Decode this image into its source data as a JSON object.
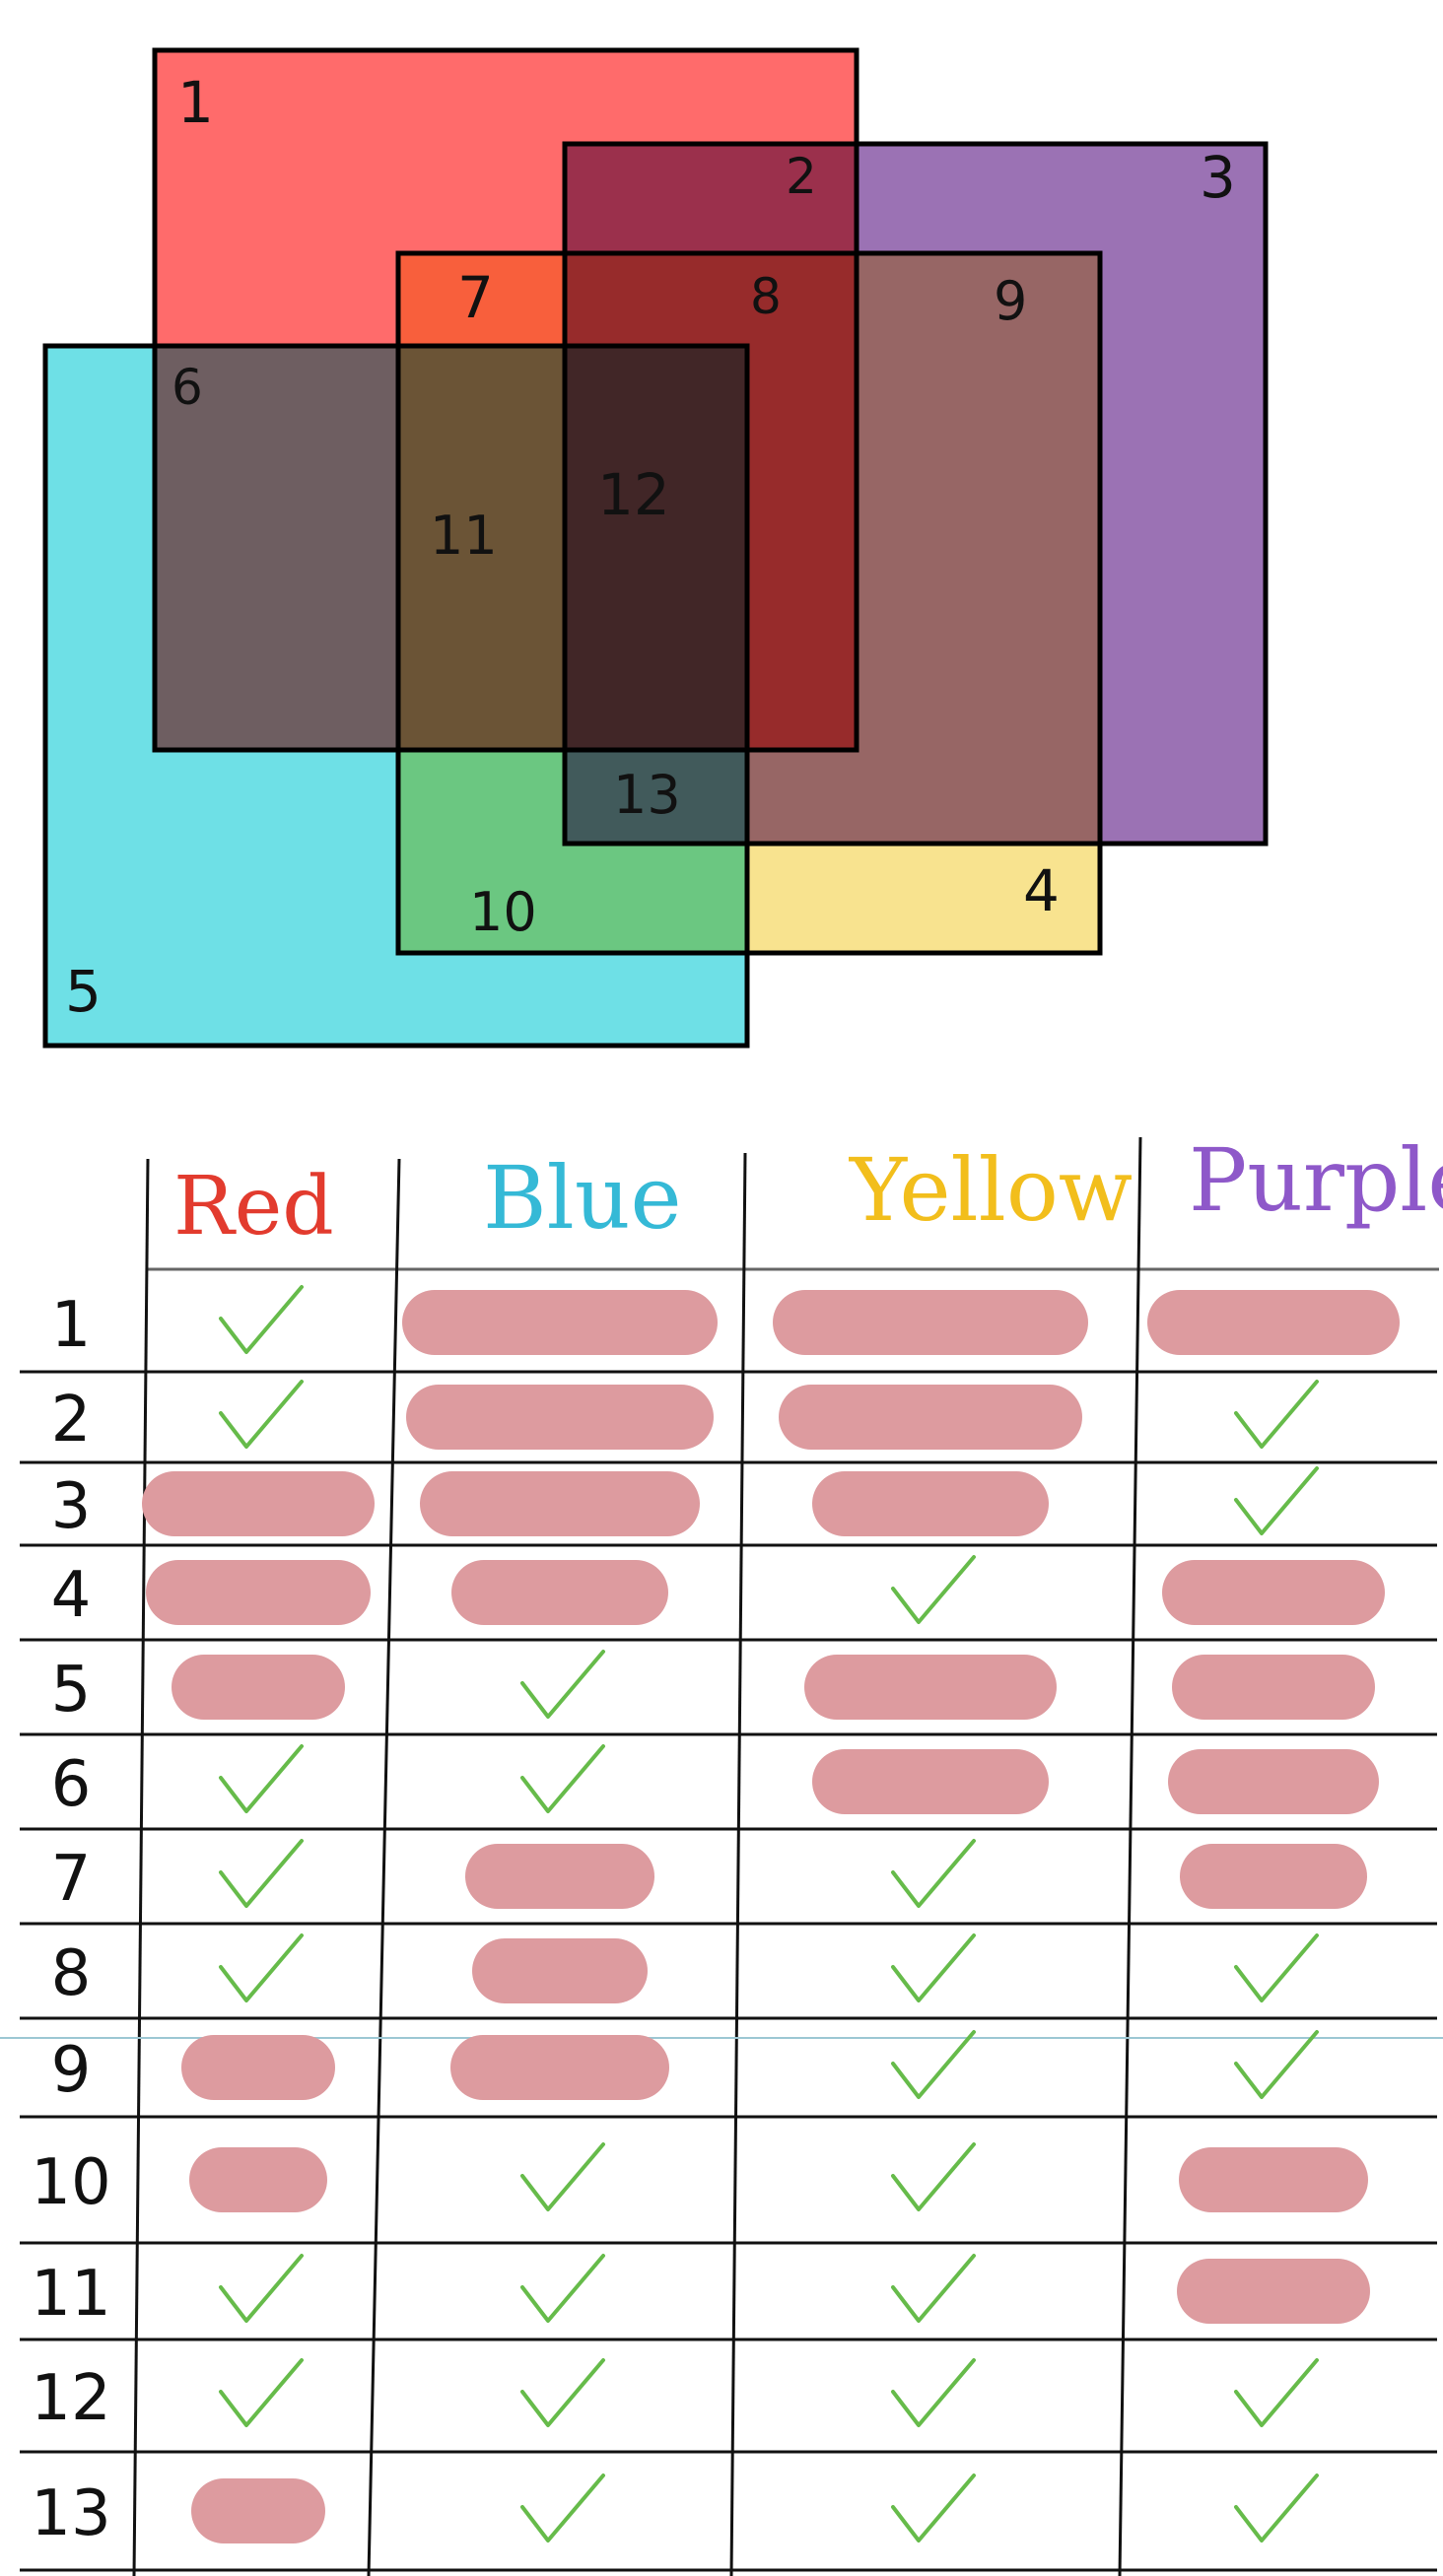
{
  "colors": {
    "red": "#ff6b6b",
    "purple": "#9b72b4",
    "yellow": "#f8e38f",
    "cyan": "#6ee0e6",
    "check": "#66bb4a",
    "redaction": "#dd9b9f",
    "header_red": "#e23b2e",
    "header_blue": "#35b9d6",
    "header_yellow": "#f2be1c",
    "header_purple": "#8e58c9"
  },
  "venn": {
    "squares": [
      "red",
      "purple",
      "yellow",
      "cyan"
    ],
    "region_labels": [
      "1",
      "2",
      "3",
      "4",
      "5",
      "6",
      "7",
      "8",
      "9",
      "10",
      "11",
      "12",
      "13"
    ]
  },
  "table": {
    "columns": [
      "Red",
      "Blue",
      "Yellow",
      "Purple"
    ],
    "rows": [
      {
        "label": "1",
        "cells": [
          "check",
          "redacted",
          "redacted",
          "redacted"
        ]
      },
      {
        "label": "2",
        "cells": [
          "check",
          "redacted",
          "redacted",
          "check"
        ]
      },
      {
        "label": "3",
        "cells": [
          "redacted",
          "redacted",
          "redacted",
          "check"
        ]
      },
      {
        "label": "4",
        "cells": [
          "redacted",
          "redacted",
          "check",
          "redacted"
        ]
      },
      {
        "label": "5",
        "cells": [
          "redacted",
          "check",
          "redacted",
          "redacted"
        ]
      },
      {
        "label": "6",
        "cells": [
          "check",
          "check",
          "redacted",
          "redacted"
        ]
      },
      {
        "label": "7",
        "cells": [
          "check",
          "redacted",
          "check",
          "redacted"
        ]
      },
      {
        "label": "8",
        "cells": [
          "check",
          "redacted",
          "check",
          "check"
        ]
      },
      {
        "label": "9",
        "cells": [
          "redacted",
          "redacted",
          "check",
          "check"
        ]
      },
      {
        "label": "10",
        "cells": [
          "redacted",
          "check",
          "check",
          "redacted"
        ]
      },
      {
        "label": "11",
        "cells": [
          "check",
          "check",
          "check",
          "redacted"
        ]
      },
      {
        "label": "12",
        "cells": [
          "check",
          "check",
          "check",
          "check"
        ]
      },
      {
        "label": "13",
        "cells": [
          "redacted",
          "check",
          "check",
          "check"
        ]
      }
    ]
  }
}
